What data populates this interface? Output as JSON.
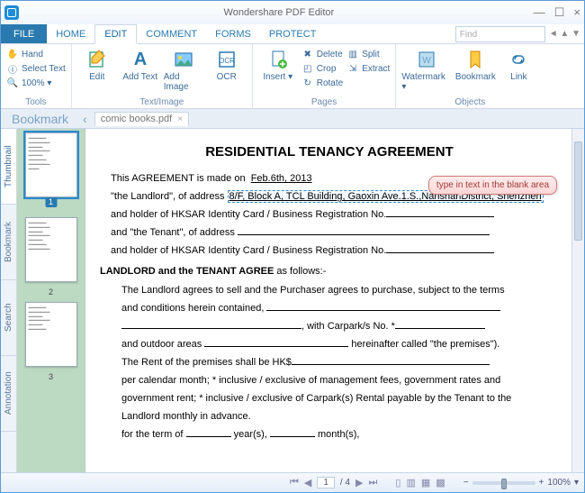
{
  "app": {
    "title": "Wondershare PDF Editor"
  },
  "win": {
    "min": "—",
    "max": "☐",
    "close": "×"
  },
  "menu": {
    "file": "FILE",
    "tabs": [
      "HOME",
      "EDIT",
      "COMMENT",
      "FORMS",
      "PROTECT"
    ],
    "active": 1,
    "find_placeholder": "Find"
  },
  "ribbon": {
    "groups": [
      {
        "label": "Tools",
        "small": [
          {
            "icon": "hand-icon",
            "text": "Hand"
          },
          {
            "icon": "select-text-icon",
            "text": "Select Text"
          },
          {
            "icon": "zoom-icon",
            "text": "100% ▾"
          }
        ]
      },
      {
        "label": "Text/Image",
        "big": [
          {
            "icon": "edit-icon",
            "text": "Edit"
          },
          {
            "icon": "add-text-icon",
            "text": "Add Text"
          },
          {
            "icon": "add-image-icon",
            "text": "Add Image"
          },
          {
            "icon": "ocr-icon",
            "text": "OCR"
          }
        ]
      },
      {
        "label": "Pages",
        "big": [
          {
            "icon": "insert-icon",
            "text": "Insert ▾"
          }
        ],
        "small": [
          {
            "icon": "delete-icon",
            "text": "Delete"
          },
          {
            "icon": "crop-icon",
            "text": "Crop"
          },
          {
            "icon": "rotate-icon",
            "text": "Rotate"
          }
        ],
        "small2": [
          {
            "icon": "split-icon",
            "text": "Split"
          },
          {
            "icon": "extract-icon",
            "text": "Extract"
          }
        ]
      },
      {
        "label": "Objects",
        "big": [
          {
            "icon": "watermark-icon",
            "text": "Watermark ▾"
          },
          {
            "icon": "bookmark-icon",
            "text": "Bookmark"
          },
          {
            "icon": "link-icon",
            "text": "Link"
          }
        ]
      }
    ]
  },
  "tabstrip": {
    "bookmark": "Bookmark",
    "doc": "comic books.pdf"
  },
  "sidetabs": [
    "Thumbnail",
    "Bookmark",
    "Search",
    "Annotation"
  ],
  "thumbs": [
    1,
    2,
    3
  ],
  "doc": {
    "title": "RESIDENTIAL TENANCY AGREEMENT",
    "line1a": "This AGREEMENT is made on",
    "date": "Feb.6th, 2013",
    "line2a": "\"the Landlord\", of address",
    "addr": "8/F, Block A, TCL Building, Gaoxin Ave.1.S.,NanshanDistrict, Shenzhen",
    "line3": "and holder of HKSAR Identity Card / Business Registration No.",
    "line4": "and \"the Tenant\", of address",
    "line5": "and holder of HKSAR Identity Card / Business Registration No.",
    "heading2a": "LANDLORD and the TENANT AGREE",
    "heading2b": " as follows:-",
    "p1": "The Landlord agrees to sell and the Purchaser agrees to purchase, subject to the terms",
    "p2": "and conditions herein contained,",
    "p3mid": ", with Carpark/s No. *",
    "p4a": "and outdoor areas",
    "p4b": " hereinafter called \"the premises\").",
    "p5": "The Rent of the premises shall be HK$",
    "p6": "per calendar month;  * inclusive / exclusive of management fees, government rates and",
    "p7": "government rent; * inclusive / exclusive of Carpark(s) Rental payable by the Tenant to the",
    "p8": "Landlord monthly in advance.",
    "p9a": "for the term of",
    "p9b": " year(s),",
    "p9c": " month(s),",
    "callout": "type in text in the blank area"
  },
  "status": {
    "page_current": "1",
    "page_total": "/ 4",
    "zoom": "100%"
  }
}
